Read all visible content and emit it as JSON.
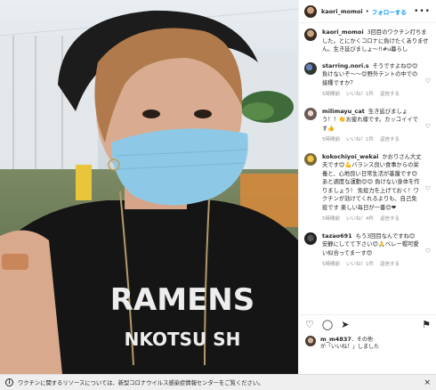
{
  "post": {
    "author": "kaori_momoi",
    "follow_label": "フォローする",
    "more_icon": "ellipsis-icon"
  },
  "comments": [
    {
      "user": "kaori_momoi",
      "text": "3回目のワクチン打ちました。とにかくコロナに負けたくありません。生き延びましょ〜!!#u暮らし",
      "meta": []
    },
    {
      "user": "starring.nori.s",
      "text": "そうですよね😊😊負けないぞ〜〜😊野外テントの中での接種ですか？",
      "meta": [
        "5時間前",
        "いいね！1件",
        "返信する"
      ]
    },
    {
      "user": "milimayu_cat",
      "text": "生き延びましょう！！👏お疲れ様です。カッコイイです👍",
      "meta": [
        "5時間前",
        "いいね！1件",
        "返信する"
      ]
    },
    {
      "user": "kokochiyoi_wekai",
      "text": "かおりさん大丈夫です😊💪バランス良い食事からの栄養と、心地良い日常生活が基盤です😊 あと適度な運動😊😊 負けない身体を作りましょう！ 免疫力を上げておく！ワクチンが効けてくれるよりも、自己免疫です 楽しい毎日が一番😊❤",
      "meta": [
        "5時間前",
        "いいね！4件",
        "返信する"
      ]
    },
    {
      "user": "tazao691",
      "text": "もう3回目なんですね😊 安静にしてて下さい😊🙏ベレー帽可愛い似合ってまーす😍",
      "meta": [
        "5時間前",
        "いいね！1件",
        "返信する"
      ]
    }
  ],
  "likes": {
    "user": "m_m4837",
    "text_after_user": "、その他",
    "text_line2": "が「いいね！」しました"
  },
  "banner": {
    "info_icon": "i",
    "text": "ワクチンに関するリソースについては、新型コロナウイルス感染症情報センターをご覧ください。",
    "close": "×"
  },
  "photo": {
    "shirt_text": "RAMENS",
    "shirt_subtext": "NKOTSU SH"
  }
}
